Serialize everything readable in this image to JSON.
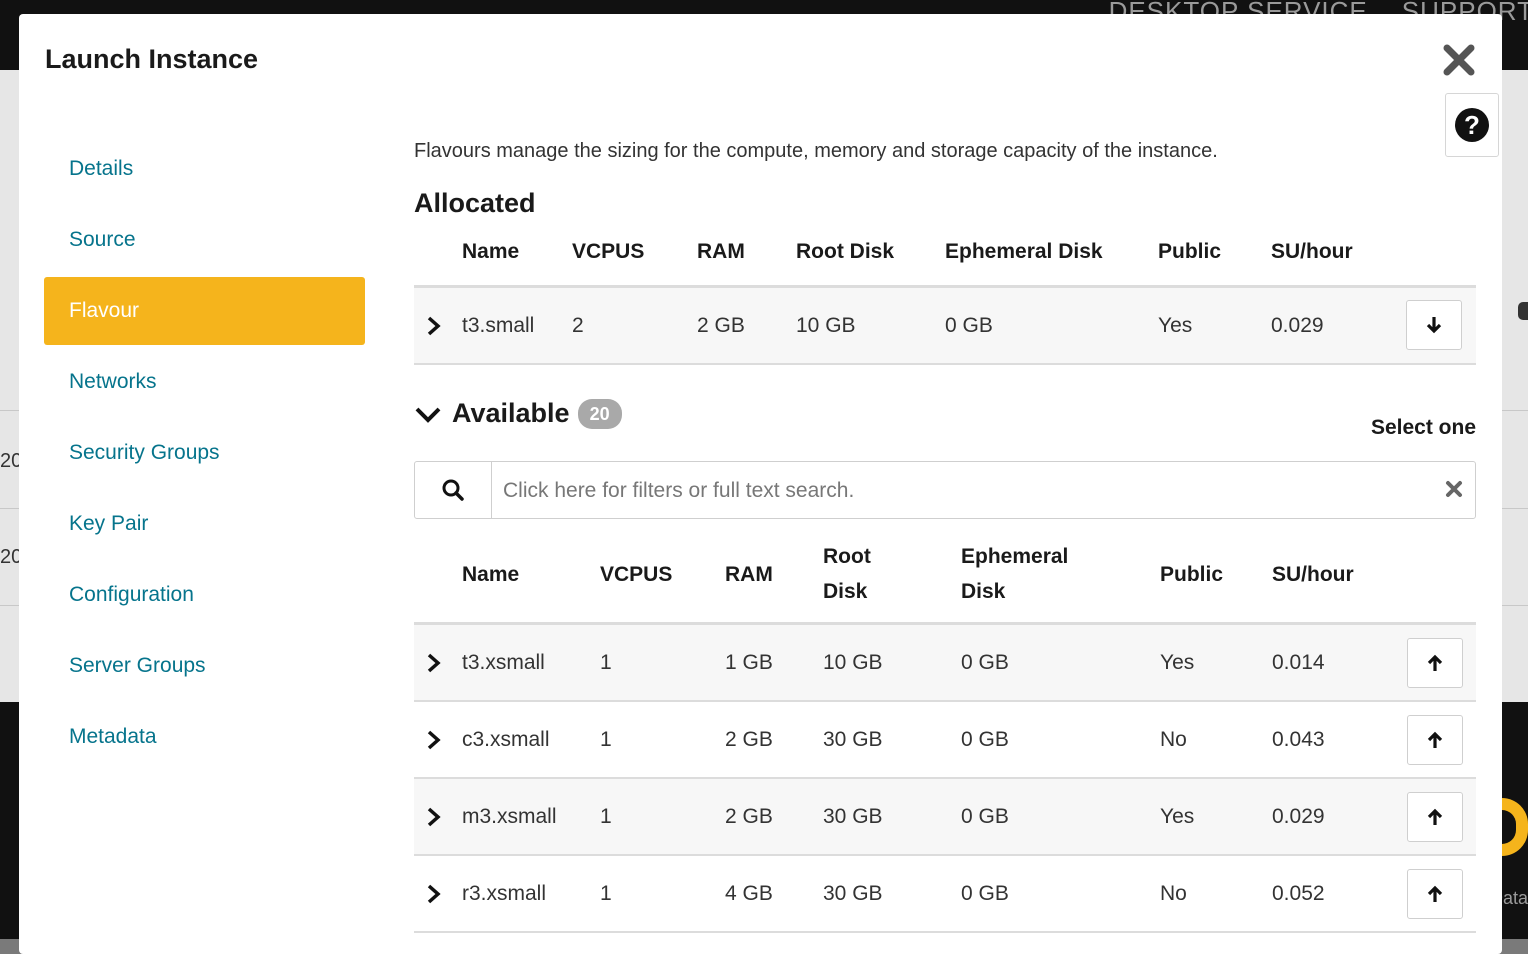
{
  "background": {
    "nav": [
      "DESKTOP SERVICE",
      "SUPPORT"
    ],
    "row_numbers": [
      "20",
      "20"
    ],
    "footer_text": "Data"
  },
  "modal": {
    "title": "Launch Instance",
    "close_icon": "close-icon",
    "help_icon": "question-circle-icon"
  },
  "sidebar": {
    "items": [
      {
        "label": "Details"
      },
      {
        "label": "Source"
      },
      {
        "label": "Flavour",
        "active": true
      },
      {
        "label": "Networks"
      },
      {
        "label": "Security Groups"
      },
      {
        "label": "Key Pair"
      },
      {
        "label": "Configuration"
      },
      {
        "label": "Server Groups"
      },
      {
        "label": "Metadata"
      }
    ]
  },
  "content": {
    "intro": "Flavours manage the sizing for the compute, memory and storage capacity of the instance.",
    "allocated": {
      "title": "Allocated",
      "headers": {
        "name": "Name",
        "vcpus": "VCPUS",
        "ram": "RAM",
        "root_disk": "Root Disk",
        "ephemeral_disk": "Ephemeral Disk",
        "public": "Public",
        "su_hour": "SU/hour"
      },
      "rows": [
        {
          "name": "t3.small",
          "vcpus": "2",
          "ram": "2 GB",
          "root_disk": "10 GB",
          "ephemeral_disk": "0 GB",
          "public": "Yes",
          "su_hour": "0.029"
        }
      ]
    },
    "available": {
      "title": "Available",
      "count": "20",
      "select_one": "Select one",
      "search_placeholder": "Click here for filters or full text search.",
      "headers": {
        "name": "Name",
        "vcpus": "VCPUS",
        "ram": "RAM",
        "root_disk_1": "Root",
        "root_disk_2": "Disk",
        "ephemeral_disk_1": "Ephemeral",
        "ephemeral_disk_2": "Disk",
        "public": "Public",
        "su_hour": "SU/hour"
      },
      "rows": [
        {
          "name": "t3.xsmall",
          "vcpus": "1",
          "ram": "1 GB",
          "root_disk": "10 GB",
          "ephemeral_disk": "0 GB",
          "public": "Yes",
          "su_hour": "0.014"
        },
        {
          "name": "c3.xsmall",
          "vcpus": "1",
          "ram": "2 GB",
          "root_disk": "30 GB",
          "ephemeral_disk": "0 GB",
          "public": "No",
          "su_hour": "0.043"
        },
        {
          "name": "m3.xsmall",
          "vcpus": "1",
          "ram": "2 GB",
          "root_disk": "30 GB",
          "ephemeral_disk": "0 GB",
          "public": "Yes",
          "su_hour": "0.029"
        },
        {
          "name": "r3.xsmall",
          "vcpus": "1",
          "ram": "4 GB",
          "root_disk": "30 GB",
          "ephemeral_disk": "0 GB",
          "public": "No",
          "su_hour": "0.052"
        }
      ]
    }
  },
  "colors": {
    "accent": "#f5b41c",
    "link": "#06748c"
  }
}
